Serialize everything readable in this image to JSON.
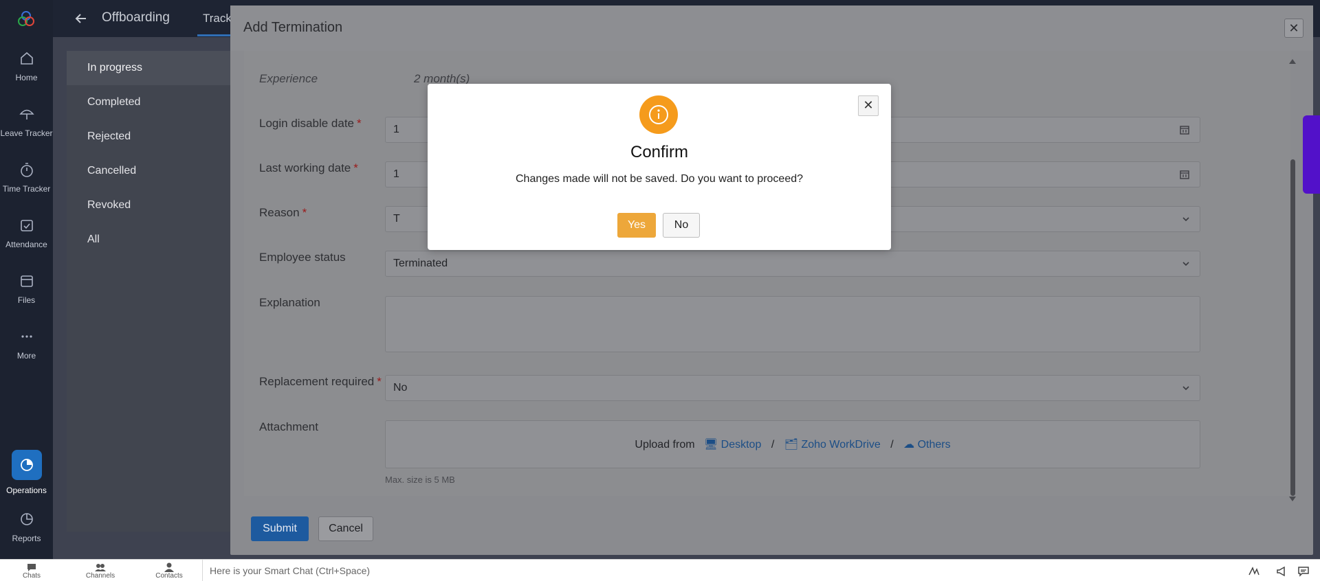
{
  "rail": {
    "items": [
      {
        "label": "Home",
        "icon": "home-icon"
      },
      {
        "label": "Leave Tracker",
        "icon": "umbrella-icon"
      },
      {
        "label": "Time Tracker",
        "icon": "stopwatch-icon"
      },
      {
        "label": "Attendance",
        "icon": "calendar-check-icon"
      },
      {
        "label": "Files",
        "icon": "folder-icon"
      },
      {
        "label": "More",
        "icon": "more-icon"
      },
      {
        "label": "Operations",
        "icon": "operations-icon"
      },
      {
        "label": "Reports",
        "icon": "pie-chart-icon"
      }
    ]
  },
  "header": {
    "title": "Offboarding",
    "tab": "Track"
  },
  "subnav": {
    "items": [
      "In progress",
      "Completed",
      "Rejected",
      "Cancelled",
      "Revoked",
      "All"
    ]
  },
  "drawer": {
    "title": "Add Termination",
    "fields": {
      "experience_label": "Experience",
      "experience_value": "2 month(s)",
      "login_disable_label": "Login disable date",
      "login_disable_value": "1",
      "last_working_label": "Last working date",
      "last_working_value": "1",
      "reason_label": "Reason",
      "reason_value": "T",
      "employee_status_label": "Employee status",
      "employee_status_value": "Terminated",
      "explanation_label": "Explanation",
      "replacement_label": "Replacement required",
      "replacement_value": "No",
      "attachment_label": "Attachment",
      "upload_from": "Upload from",
      "upload_desktop": "Desktop",
      "upload_workdrive": "Zoho WorkDrive",
      "upload_others": "Others",
      "upload_sep": "/",
      "max_size": "Max. size is 5 MB"
    },
    "required_mark": "*",
    "submit_label": "Submit",
    "cancel_label": "Cancel"
  },
  "modal": {
    "title": "Confirm",
    "message": "Changes made will not be saved. Do you want to proceed?",
    "yes_label": "Yes",
    "no_label": "No"
  },
  "bottombar": {
    "chats": "Chats",
    "channels": "Channels",
    "contacts": "Contacts",
    "smartchat_placeholder": "Here is your Smart Chat (Ctrl+Space)"
  },
  "colors": {
    "accent": "#1f6fc0",
    "warning": "#f59b1c",
    "yes_button": "#eda73a",
    "side_tab": "#5211c9"
  }
}
